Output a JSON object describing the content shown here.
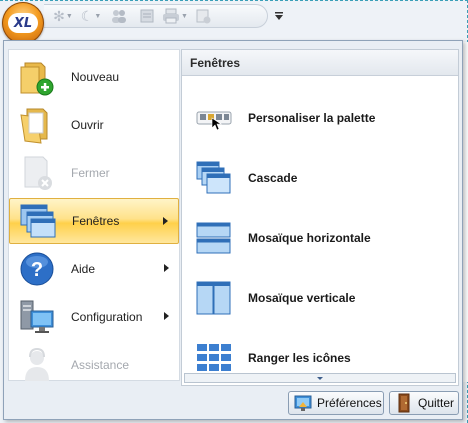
{
  "app": {
    "logo_text": "XL"
  },
  "quick_access": {
    "icons": [
      "sun-icon",
      "moon-icon",
      "users-icon",
      "document-icon",
      "printer-icon",
      "new-page-icon"
    ]
  },
  "main_menu": {
    "items": [
      {
        "label": "Nouveau",
        "icon": "new-folder-icon",
        "disabled": false,
        "submenu": false
      },
      {
        "label": "Ouvrir",
        "icon": "open-folder-icon",
        "disabled": false,
        "submenu": false
      },
      {
        "label": "Fermer",
        "icon": "close-document-icon",
        "disabled": true,
        "submenu": false
      },
      {
        "label": "Fenêtres",
        "icon": "windows-icon",
        "disabled": false,
        "submenu": true,
        "selected": true
      },
      {
        "label": "Aide",
        "icon": "help-icon",
        "disabled": false,
        "submenu": true
      },
      {
        "label": "Configuration",
        "icon": "configuration-icon",
        "disabled": false,
        "submenu": true
      },
      {
        "label": "Assistance",
        "icon": "assistance-icon",
        "disabled": true,
        "submenu": false
      }
    ]
  },
  "submenu": {
    "title": "Fenêtres",
    "items": [
      {
        "label": "Personaliser la palette",
        "icon": "palette-icon"
      },
      {
        "label": "Cascade",
        "icon": "cascade-icon"
      },
      {
        "label": "Mosaïque horizontale",
        "icon": "tile-horizontal-icon"
      },
      {
        "label": "Mosaïque verticale",
        "icon": "tile-vertical-icon"
      },
      {
        "label": "Ranger les icônes",
        "icon": "arrange-icons-icon"
      }
    ]
  },
  "footer": {
    "preferences_label": "Préférences",
    "quit_label": "Quitter"
  }
}
